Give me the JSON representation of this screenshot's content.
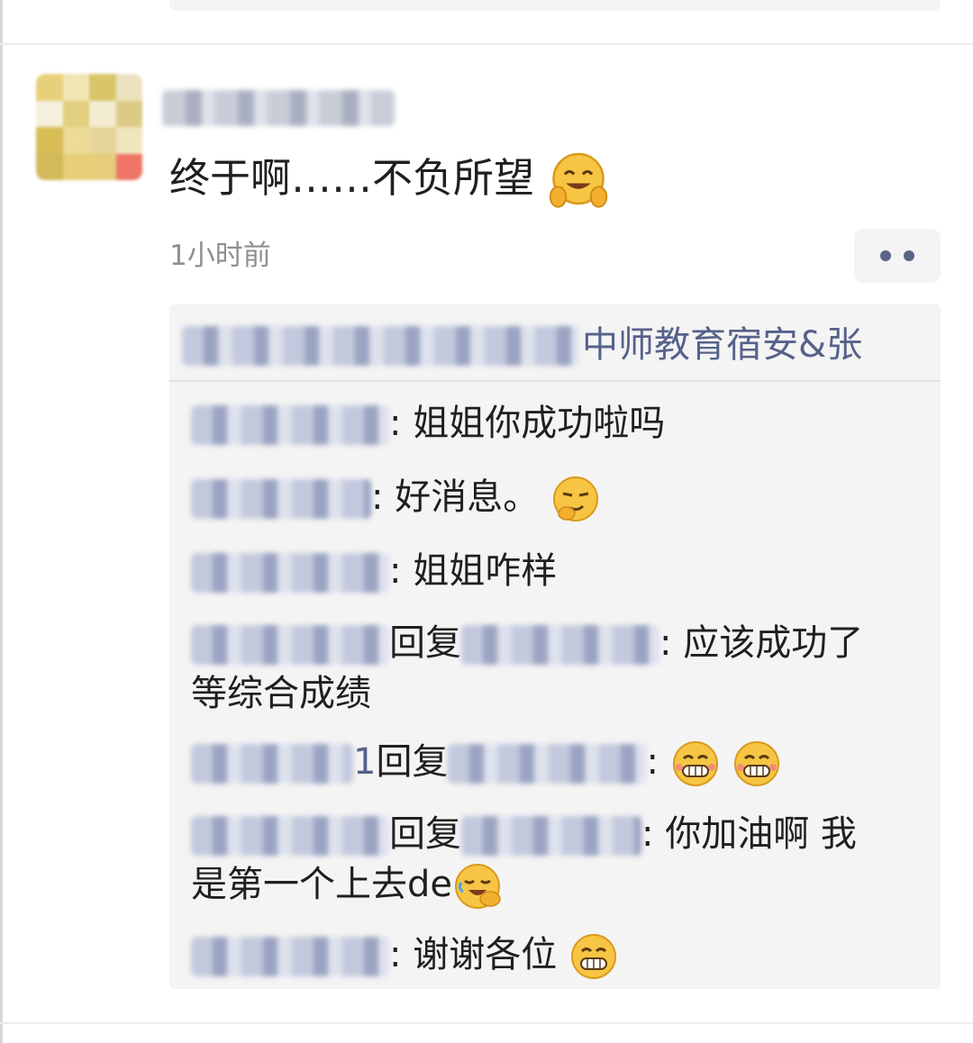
{
  "post": {
    "text": "终于啊……不负所望",
    "time": "1小时前"
  },
  "likes": {
    "visible_name": "中师教育宿安&张"
  },
  "comments": [
    {
      "sep": ": ",
      "text": "姐姐你成功啦吗"
    },
    {
      "sep": ": ",
      "text": "好消息。"
    },
    {
      "sep": ": ",
      "text": "姐姐咋样"
    },
    {
      "reply_label": "回复",
      "sep": ": ",
      "text": "应该成功了",
      "text2": "等综合成绩"
    },
    {
      "reply_prefix": "1",
      "reply_label": "回复",
      "sep": ": ",
      "text": ""
    },
    {
      "reply_label": "回复",
      "sep": ": ",
      "text": "你加油啊 我",
      "text2": "是第一个上去de"
    },
    {
      "sep": ": ",
      "text": "谢谢各位"
    }
  ],
  "icons": {
    "post_emoji": "hug-emoji",
    "c2_emoji": "thinking-smirk-emoji",
    "c5_emoji": "grin-emoji",
    "c6_emoji": "facepalm-laugh-emoji",
    "c7_emoji": "grin-emoji",
    "more": "more-dots-icon"
  },
  "colors": {
    "name_blue": "#57628a",
    "text": "#1f1f1f",
    "time_gray": "#8f8f8f",
    "comment_bg": "#f4f4f4"
  }
}
